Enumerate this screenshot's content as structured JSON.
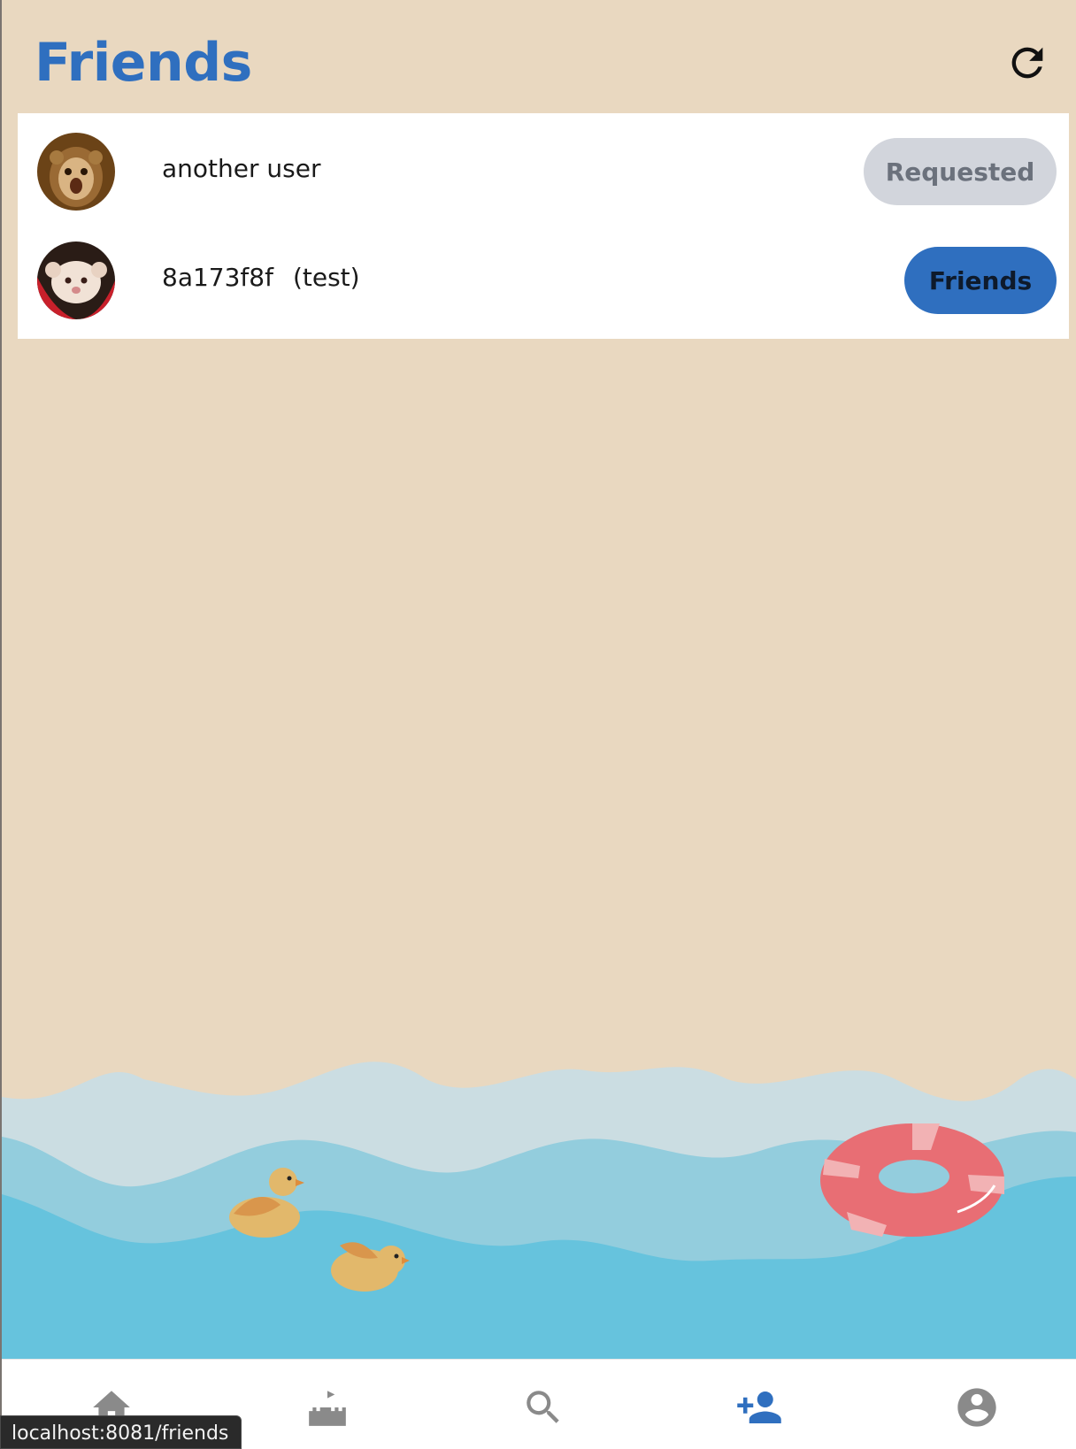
{
  "header": {
    "title": "Friends",
    "refresh_icon": "refresh-icon"
  },
  "friends": [
    {
      "name": "another user",
      "nickname": "",
      "status": "Requested",
      "avatar_color": "#7a4e1c"
    },
    {
      "name": "8a173f8f",
      "nickname": "(test)",
      "status": "Friends",
      "avatar_color": "#c8202b"
    }
  ],
  "bottom_nav": {
    "items": [
      {
        "icon": "home-icon",
        "active": false
      },
      {
        "icon": "castle-icon",
        "active": false
      },
      {
        "icon": "search-icon",
        "active": false
      },
      {
        "icon": "add-friend-icon",
        "active": true
      },
      {
        "icon": "account-icon",
        "active": false
      }
    ]
  },
  "status_bar": {
    "url": "localhost:8081/friends"
  },
  "colors": {
    "accent": "#2f6fbf",
    "background": "#e9d8c0",
    "requested_bg": "#d2d5dc",
    "sea_light": "#cbdde2",
    "sea_mid": "#93cddd",
    "sea_deep": "#66c3dd",
    "float_ring": "#e86e74"
  }
}
